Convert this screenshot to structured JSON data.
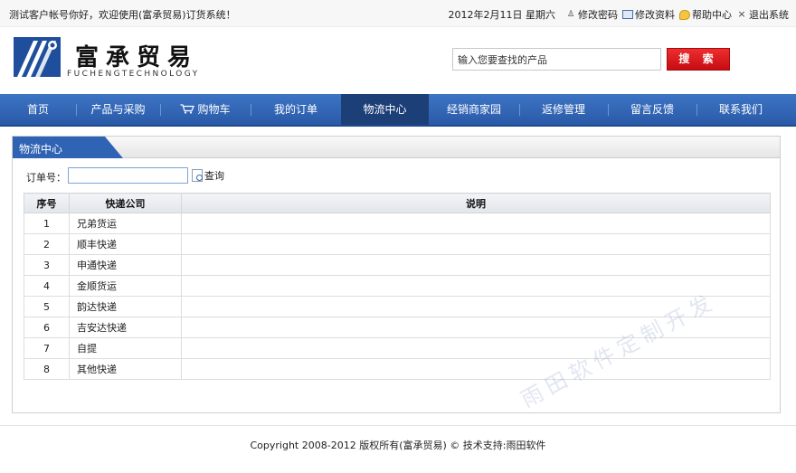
{
  "topbar": {
    "welcome": "测试客户帐号你好，欢迎使用(富承贸易)订货系统！",
    "date": "2012年2月11日  星期六",
    "change_password": "修改密码",
    "edit_profile": "修改资料",
    "help_center": "帮助中心",
    "logout": "退出系统"
  },
  "brand": {
    "name_cn": "富承贸易",
    "name_en": "FUCHENGTECHNOLOGY"
  },
  "search": {
    "value": "输入您要查找的产品",
    "button_label": "搜 索"
  },
  "nav": {
    "items": [
      {
        "label": "首页"
      },
      {
        "label": "产品与采购"
      },
      {
        "label": "购物车"
      },
      {
        "label": "我的订单"
      },
      {
        "label": "物流中心"
      },
      {
        "label": "经销商家园"
      },
      {
        "label": "返修管理"
      },
      {
        "label": "留言反馈"
      },
      {
        "label": "联系我们"
      }
    ],
    "active_index": 4
  },
  "panel": {
    "title": "物流中心",
    "order_label": "订单号：",
    "order_value": "",
    "query_label": "查询"
  },
  "table": {
    "headers": [
      "序号",
      "快递公司",
      "说明"
    ],
    "rows": [
      [
        "1",
        "兄弟货运",
        ""
      ],
      [
        "2",
        "顺丰快递",
        ""
      ],
      [
        "3",
        "申通快递",
        ""
      ],
      [
        "4",
        "金顺货运",
        ""
      ],
      [
        "5",
        "韵达快递",
        ""
      ],
      [
        "6",
        "吉安达快递",
        ""
      ],
      [
        "7",
        "自提",
        ""
      ],
      [
        "8",
        "其他快递",
        ""
      ]
    ]
  },
  "watermark": "雨田软件定制开发",
  "footer": "Copyright 2008-2012 版权所有(富承贸易) © 技术支持:雨田软件",
  "colors": {
    "nav_bg": "#2f63b3",
    "nav_active": "#1c3f78",
    "search_button": "#d20f16",
    "panel_tab": "#2f63b3"
  }
}
